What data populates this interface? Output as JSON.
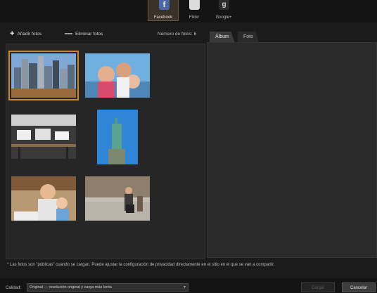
{
  "services": [
    {
      "label": "Facebook",
      "glyph": "f"
    },
    {
      "label": "Flickr",
      "glyph": ""
    },
    {
      "label": "Google+",
      "glyph": "g"
    }
  ],
  "toolbar": {
    "add_label": "Añadir fotos",
    "remove_label": "Eliminar fotos",
    "photo_count": "Número de fotos: 6"
  },
  "tabs": [
    {
      "label": "Álbum"
    },
    {
      "label": "Foto"
    }
  ],
  "photos": [
    {
      "subject": "city-skyline",
      "selected": true
    },
    {
      "subject": "family-portrait",
      "selected": false
    },
    {
      "subject": "restaurant-interior",
      "selected": false
    },
    {
      "subject": "statue-of-liberty",
      "selected": false
    },
    {
      "subject": "mother-and-child-cafe",
      "selected": false
    },
    {
      "subject": "street-stroller",
      "selected": false
    }
  ],
  "notice": "* Las fotos son \"públicas\" cuando se cargan. Puede ajustar la configuración de privacidad directamente en el sitio en el que se van a compartir.",
  "footer": {
    "quality_label": "Calidad:",
    "quality_value": "Original — resolución original y carga más lenta",
    "upload_label": "Cargar",
    "cancel_label": "Cancelar"
  },
  "colors": {
    "accent": "#c88a2a",
    "facebook": "#4a68a8"
  }
}
